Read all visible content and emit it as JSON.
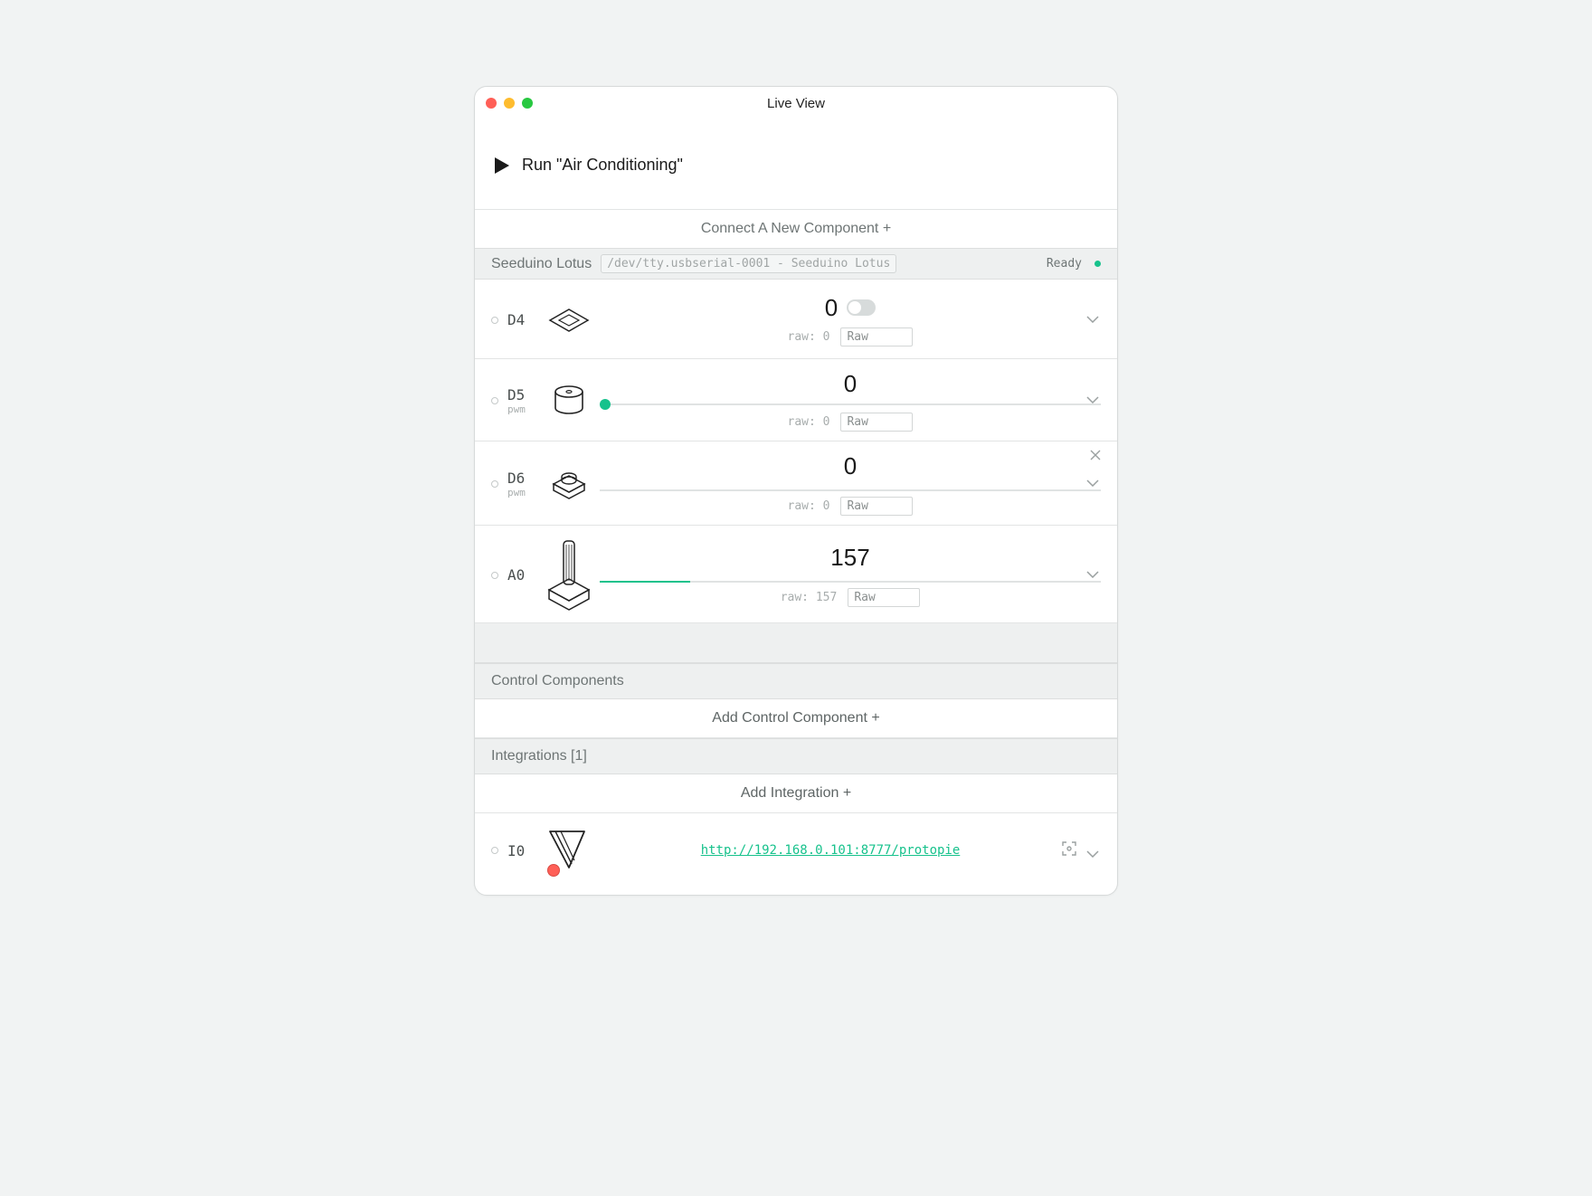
{
  "window": {
    "title": "Live View"
  },
  "run": {
    "label": "Run \"Air Conditioning\""
  },
  "connect": {
    "label": "Connect A New Component +"
  },
  "device": {
    "name": "Seeduino Lotus",
    "path": "/dev/tty.usbserial-0001 - Seeduino Lotus",
    "status": "Ready"
  },
  "pins": [
    {
      "id": "D4",
      "sub": "",
      "value": "0",
      "raw": "raw: 0",
      "mode": "Raw",
      "control": "toggle"
    },
    {
      "id": "D5",
      "sub": "pwm",
      "value": "0",
      "raw": "raw: 0",
      "mode": "Raw",
      "control": "slider"
    },
    {
      "id": "D6",
      "sub": "pwm",
      "value": "0",
      "raw": "raw: 0",
      "mode": "Raw",
      "control": "none"
    },
    {
      "id": "A0",
      "sub": "",
      "value": "157",
      "raw": "raw: 157",
      "mode": "Raw",
      "control": "progress",
      "progress_pct": 18
    }
  ],
  "control_section": {
    "header": "Control Components",
    "add": "Add Control Component +"
  },
  "integrations": {
    "header": "Integrations [1]",
    "add": "Add Integration +",
    "items": [
      {
        "id": "I0",
        "url": "http://192.168.0.101:8777/protopie"
      }
    ]
  }
}
